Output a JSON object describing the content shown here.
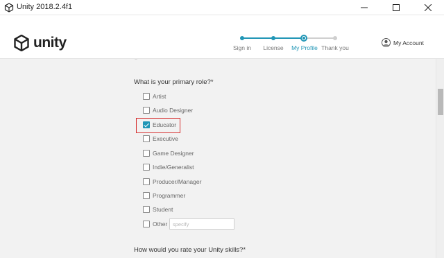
{
  "window": {
    "title": "Unity 2018.2.4f1",
    "controls": [
      "minimize-icon",
      "maximize-icon",
      "close-icon"
    ]
  },
  "header": {
    "logo_text": "unity",
    "steps": [
      {
        "label": "Sign in",
        "state": "done"
      },
      {
        "label": "License",
        "state": "done"
      },
      {
        "label": "My Profile",
        "state": "current"
      },
      {
        "label": "Thank you",
        "state": "todo"
      }
    ],
    "account_label": "My Account"
  },
  "form": {
    "role_question": "What is your primary role?*",
    "roles": [
      {
        "label": "Artist",
        "checked": false
      },
      {
        "label": "Audio Designer",
        "checked": false
      },
      {
        "label": "Educator",
        "checked": true
      },
      {
        "label": "Executive",
        "checked": false
      },
      {
        "label": "Game Designer",
        "checked": false
      },
      {
        "label": "Indie/Generalist",
        "checked": false
      },
      {
        "label": "Producer/Manager",
        "checked": false
      },
      {
        "label": "Programmer",
        "checked": false
      },
      {
        "label": "Student",
        "checked": false
      },
      {
        "label": "Other",
        "checked": false
      }
    ],
    "other_placeholder": "specify",
    "skills_question": "How would you rate your Unity skills?*"
  },
  "colors": {
    "accent": "#2196b6",
    "highlight": "#d62f2f",
    "content_bg": "#f2f2f2"
  }
}
